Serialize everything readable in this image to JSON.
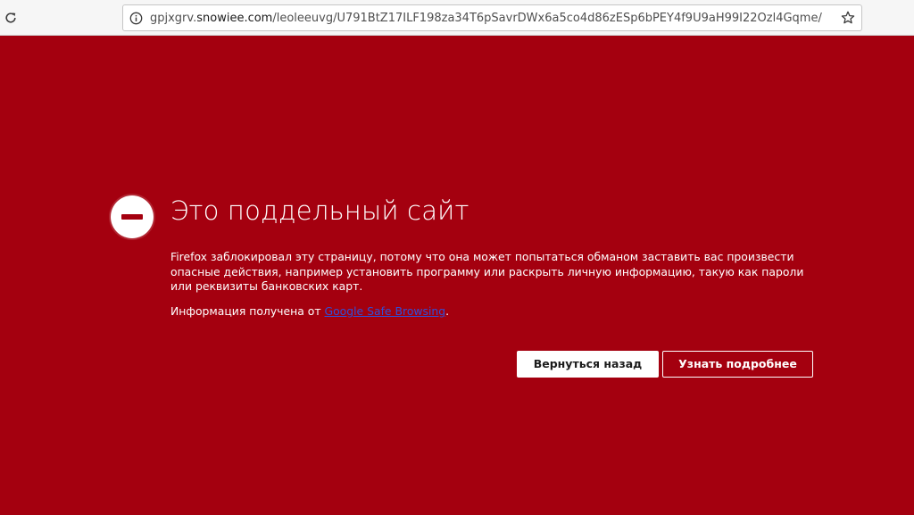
{
  "browser": {
    "url_prefix": "gpjxgrv.",
    "url_domain": "snowiee.com",
    "url_path": "/leoleeuvg/U791BtZ17ILF198za34T6pSavrDWx6a5co4d86zESp6bPEY4f9U9aH99I22Ozl4Gqme/",
    "icons": {
      "reload": "reload-icon",
      "info": "info-icon",
      "bookmark": "star-icon"
    }
  },
  "error_page": {
    "title": "Это поддельный сайт",
    "description": "Firefox заблокировал эту страницу, потому что она может попытаться обманом заставить вас произвести опасные действия, например установить программу или раскрыть личную информацию, такую как пароли или реквизиты банковских карт.",
    "source_prefix": "Информация получена от ",
    "source_link": "Google Safe Browsing",
    "source_suffix": ".",
    "go_back_label": "Вернуться назад",
    "learn_more_label": "Узнать подробнее"
  },
  "colors": {
    "background": "#a4000f",
    "link": "#2f4fd8",
    "toolbar": "#f6f6f6"
  }
}
